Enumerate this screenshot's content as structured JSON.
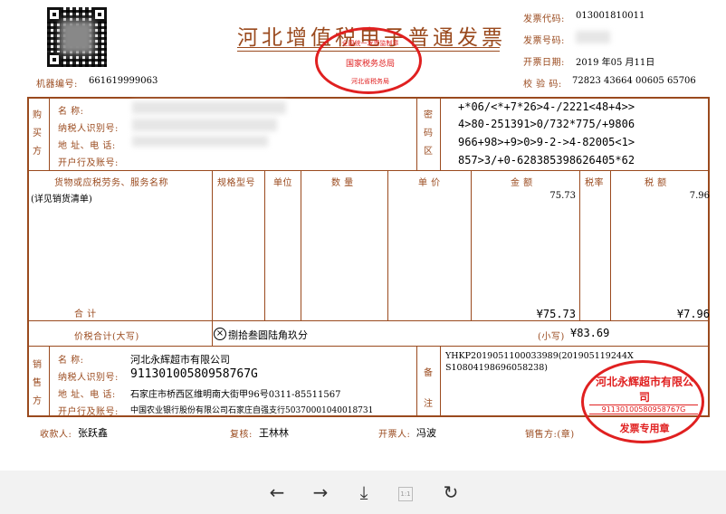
{
  "header": {
    "title": "河北增值税电子普通发票",
    "machine_no_label": "机器编号:",
    "machine_no": "661619999063",
    "code_label": "发票代码:",
    "code": "013001810011",
    "number_label": "发票号码:",
    "date_label": "开票日期:",
    "date": "2019 年05 月11日",
    "check_label": "校 验 码:",
    "check_code": "72823 43664 00605 65706"
  },
  "buyer": {
    "section_label": "购买方",
    "name_label": "名        称:",
    "taxid_label": "纳税人识别号:",
    "addr_label": "地 址、电 话:",
    "bank_label": "开户行及账号:"
  },
  "cipher": {
    "section_label": "密码区",
    "lines": [
      "+*06/<*+7*26>4-/2221<48+4>>",
      "4>80-251391>0/732*775/+9806",
      "966+98>+9>0>9-2->4-82005<1>",
      "857>3/+0-628385398626405*62"
    ]
  },
  "items": {
    "headers": {
      "name": "货物或应税劳务、服务名称",
      "spec": "规格型号",
      "unit": "单位",
      "qty": "数 量",
      "price": "单 价",
      "amount": "金 额",
      "rate": "税率",
      "tax": "税 额"
    },
    "row": {
      "name": "(详见销货清单)",
      "amount": "75.73",
      "tax": "7.96"
    },
    "total_label": "合    计",
    "total_amount": "¥75.73",
    "total_tax": "¥7.96"
  },
  "grand_total": {
    "label": "价税合计(大写)",
    "words": "捌拾叁圆陆角玖分",
    "small_label": "(小写)",
    "small_value": "¥83.69"
  },
  "seller": {
    "section_label": "销售方",
    "name_label": "名        称:",
    "name": "河北永辉超市有限公司",
    "taxid_label": "纳税人识别号:",
    "taxid": "91130100580958767G",
    "addr_label": "地 址、电 话:",
    "addr": "石家庄市桥西区维明南大街甲96号0311-85511567",
    "bank_label": "开户行及账号:",
    "bank": "中国农业银行股份有限公司石家庄自强支行50370001040018731"
  },
  "remarks": {
    "section_label": "备注",
    "text": "YHKP20190511000339​89(20190511924​4XS10804198696058238)"
  },
  "footer": {
    "payee_label": "收款人:",
    "payee": "张跃鑫",
    "reviewer_label": "复核:",
    "reviewer": "王林林",
    "issuer_label": "开票人:",
    "issuer": "冯波",
    "seller_label": "销售方:(章)"
  },
  "stamps": {
    "tax_bureau": {
      "top": "全国统一发票监制章",
      "middle": "国家税务总局",
      "bottom": "河北省税务局"
    },
    "seller": {
      "top": "河北永辉超市有限公司",
      "middle": "91130100580958767G",
      "bottom": "发票专用章"
    }
  },
  "toolbar": {
    "prev_icon": "arrow-left-icon",
    "next_icon": "arrow-right-icon",
    "download_icon": "download-icon",
    "page_icon": "page-icon",
    "page_label": "1:1",
    "rotate_icon": "rotate-icon"
  },
  "colors": {
    "frame": "#9a4a1e",
    "stamp": "#e02020",
    "toolbar": "#f2f2f2"
  }
}
